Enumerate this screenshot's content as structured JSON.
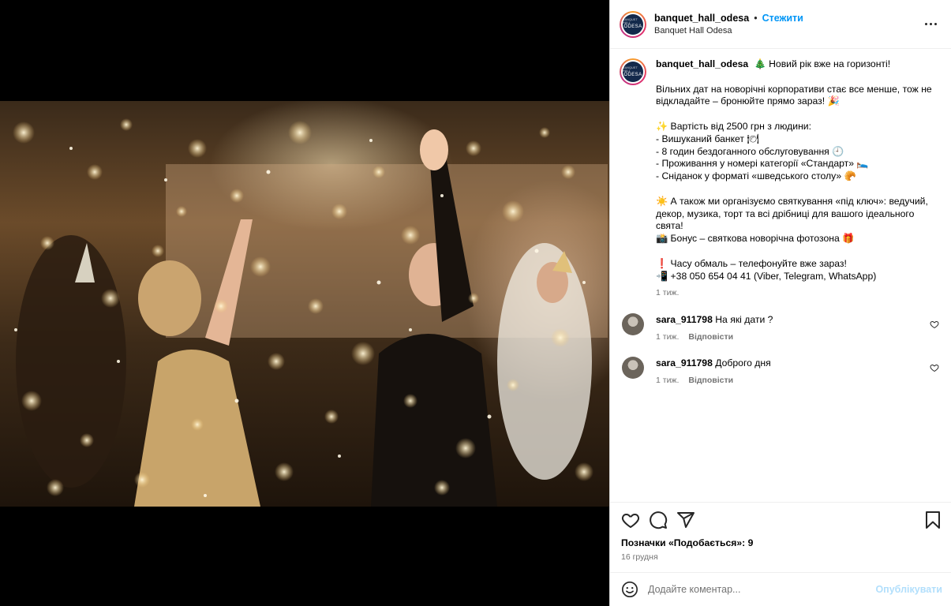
{
  "account": {
    "username": "banquet_hall_odesa",
    "location": "Banquet Hall Odesa",
    "follow_label": "Стежити",
    "separator": "•",
    "avatar_small_text": "BANQUET HALL",
    "avatar_big_text": "ODESA"
  },
  "caption": {
    "lines": [
      "🎄 Новий рік вже на горизонті!",
      "",
      "Вільних дат на новорічні корпоративи стає все менше, тож не відкладайте – бронюйте прямо зараз! 🎉",
      "",
      "✨ Вартість від 2500 грн з людини:",
      "- Вишуканий банкет 🍽",
      "- 8 годин бездоганного обслуговування 🕘",
      "- Проживання у номері категорії «Стандарт» 🛌",
      "- Сніданок у форматі «шведського столу» 🥐",
      "",
      "☀️ А також ми організуємо святкування «під ключ»: ведучий, декор, музика, торт та всі дрібниці для вашого ідеального свята!",
      "📸 Бонус – святкова новорічна фотозона 🎁",
      "",
      "❗ Часу обмаль – телефонуйте вже зараз!",
      "📲 +38 050 654 04 41 (Viber, Telegram, WhatsApp)"
    ],
    "time": "1 тиж."
  },
  "comments": [
    {
      "username": "sara_911798",
      "text": "На які дати ?",
      "time": "1 тиж.",
      "reply_label": "Відповісти"
    },
    {
      "username": "sara_911798",
      "text": "Доброго дня",
      "time": "1 тиж.",
      "reply_label": "Відповісти"
    }
  ],
  "actions": {
    "likes_label": "Позначки «Подобається»: 9",
    "date": "16 грудня"
  },
  "add_comment": {
    "placeholder": "Додайте коментар...",
    "publish_label": "Опублікувати"
  },
  "icons": {
    "like": "heart-icon",
    "comment": "comment-icon",
    "share": "share-icon",
    "save": "bookmark-icon",
    "emoji": "emoji-icon",
    "more": "more-options-icon"
  },
  "colors": {
    "link_blue": "#0095f6",
    "publish_disabled": "#b2dffc",
    "meta_gray": "#737373"
  }
}
